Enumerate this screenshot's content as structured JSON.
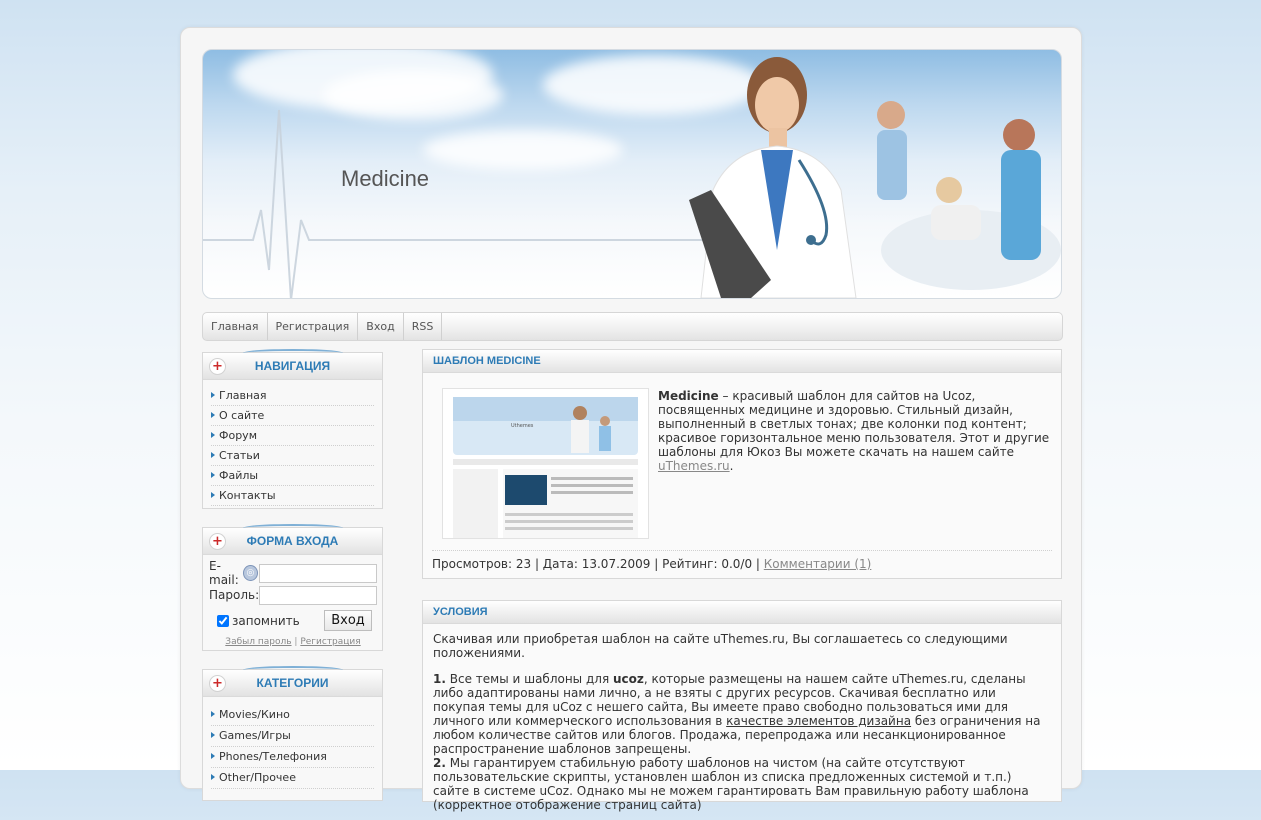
{
  "header": {
    "site_title": "Medicine"
  },
  "menu": {
    "items": [
      "Главная",
      "Регистрация",
      "Вход",
      "RSS"
    ]
  },
  "nav_block": {
    "title": "НАВИГАЦИЯ",
    "items": [
      "Главная",
      "О сайте",
      "Форум",
      "Статьи",
      "Файлы",
      "Контакты"
    ]
  },
  "login_block": {
    "title": "ФОРМА ВХОДА",
    "email_label": "E-mail:",
    "password_label": "Пароль:",
    "remember_label": "запомнить",
    "login_button": "Вход",
    "forgot_link": "Забыл пароль",
    "separator": "|",
    "register_link": "Регистрация"
  },
  "categories_block": {
    "title": "КАТЕГОРИИ",
    "items": [
      "Movies/Кино",
      "Games/Игры",
      "Phones/Телефония",
      "Other/Прочее"
    ]
  },
  "post1": {
    "title": "ШАБЛОН MEDICINE",
    "bold_name": "Medicine",
    "text": " – красивый шаблон для сайтов на Ucoz, посвященных медицине и здоровью. Стильный дизайн, выполненный в светлых тонах; две колонки под контент; красивое горизонтальное меню пользователя. Этот и другие шаблоны для Юкоз Вы можете скачать на нашем сайте ",
    "link": "uThemes.ru",
    "text_end": ".",
    "meta": "Просмотров: 23 | Дата: 13.07.2009 | Рейтинг: 0.0/0 | ",
    "comments_link": "Комментарии (1)",
    "thumb_title": "Uthemes"
  },
  "post2": {
    "title": "УСЛОВИЯ",
    "intro": "Скачивая или приобретая шаблон на сайте uThemes.ru, Вы соглашаетесь со следующими положениями.",
    "p1_num": "1.",
    "p1_a": " Все темы и шаблоны для ",
    "p1_ucoz": "ucoz",
    "p1_b": ", которые размещены на нашем сайте uThemes.ru, сделаны либо адаптированы нами лично, а не взяты с других ресурсов. Скачивая бесплатно или покупая темы для uCoz с нешего сайта, Вы имеете право свободно пользоваться ими для личного или коммерческого использования в ",
    "p1_link": "качестве элементов дизайна",
    "p1_c": " без ограничения на любом количестве сайтов или блогов. Продажа, перепродажа или несанкционированное распространение шаблонов запрещены.",
    "p2_num": "2.",
    "p2_text": " Мы гарантируем стабильную работу шаблонов на чистом (на сайте отсутствуют пользовательские скрипты, установлен шаблон из списка предложенных системой и т.п.) сайте в системе uCoz. Однако мы не можем гарантировать Вам правильную работу шаблона (корректное отображение страниц сайта)"
  },
  "colors": {
    "accent": "#2d7bb5",
    "plus": "#cc2a2a"
  }
}
